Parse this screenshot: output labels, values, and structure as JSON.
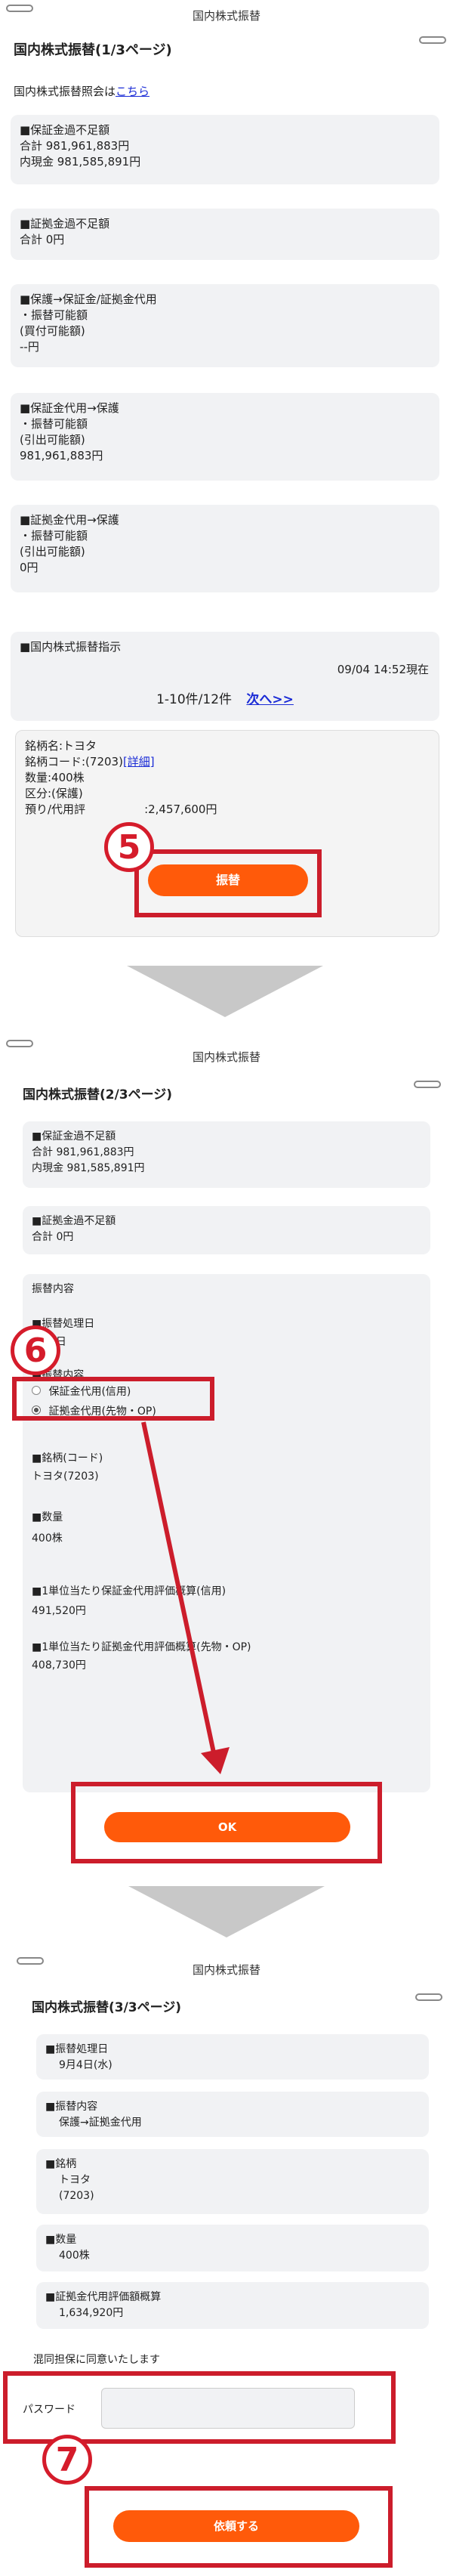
{
  "page1": {
    "header": "国内株式振替",
    "title": "国内株式振替(1/3ページ)",
    "inquiry_text": "国内株式振替照会は",
    "inquiry_link": "こちら",
    "margin_excess": [
      "■保証金過不足額",
      "合計 981,961,883円",
      "内現金 981,585,891円"
    ],
    "collateral_excess": [
      "■証拠金過不足額",
      "合計 0円"
    ],
    "margin_to_collateral": [
      "■保護→保証金/証拠金代用",
      "・振替可能額",
      "(買付可能額)",
      "--円"
    ],
    "margin_sub_to_protect": [
      "■保証金代用→保護",
      "・振替可能額",
      "(引出可能額)",
      "981,961,883円"
    ],
    "collateral_sub_to_protect": [
      "■証拠金代用→保護",
      "・振替可能額",
      "(引出可能額)",
      "0円"
    ],
    "instruction_title": "■国内株式振替指示",
    "timestamp": "09/04 14:52現在",
    "pagination": "1-10件/12件",
    "next_link": "次へ>>",
    "stock_name": "銘柄名:トヨタ",
    "stock_code_prefix": "銘柄コード:(7203)",
    "detail_link": "[詳細]",
    "quantity": "数量:400株",
    "category": "区分:(保護)",
    "valuation_prefix": "預り/代用評",
    "valuation_value": ":2,457,600円",
    "transfer_button": "振替",
    "step_number": "5"
  },
  "page2": {
    "header": "国内株式振替",
    "title": "国内株式振替(2/3ページ)",
    "margin_excess": [
      "■保証金過不足額",
      "合計 981,961,883円",
      "内現金 981,585,891円"
    ],
    "collateral_excess": [
      "■証拠金過不足額",
      "合計 0円"
    ],
    "section_label": "振替内容",
    "date_label": "■振替処理日",
    "date_value": "9月4日",
    "content_label": "■振替内容",
    "option_1": "保証金代用(信用)",
    "option_2": "証拠金代用(先物・OP)",
    "stock_label": "■銘柄(コード)",
    "stock_value": "トヨタ(7203)",
    "qty_label": "■数量",
    "qty_value": "400株",
    "per_unit_margin_label": "■1単位当たり保証金代用評価概算(信用)",
    "per_unit_margin_value": "491,520円",
    "per_unit_collateral_label": "■1単位当たり証拠金代用評価概算(先物・OP)",
    "per_unit_collateral_value": "408,730円",
    "ok_button": "OK",
    "step_number": "6"
  },
  "page3": {
    "header": "国内株式振替",
    "title": "国内株式振替(3/3ページ)",
    "date_label": "■振替処理日",
    "date_value": "9月4日(水)",
    "content_label": "■振替内容",
    "content_value": "保護→証拠金代用",
    "stock_label": "■銘柄",
    "stock_name": "トヨタ",
    "stock_code": "(7203)",
    "qty_label": "■数量",
    "qty_value": "400株",
    "valuation_label": "■証拠金代用評価額概算",
    "valuation_value": "1,634,920円",
    "consent_text": "混同担保に同意いたします",
    "password_label": "パスワード",
    "password_placeholder": "",
    "submit_button": "依頼する",
    "step_number": "7"
  },
  "colors": {
    "accent": "#ff5a0a",
    "annotation_red": "#cc1d2b",
    "link": "#1a2bd6"
  }
}
